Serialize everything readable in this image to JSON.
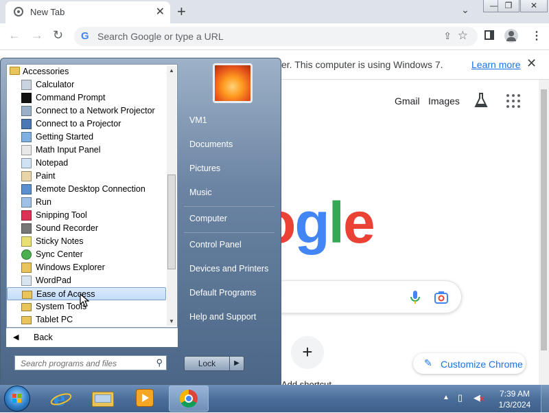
{
  "browser": {
    "tab_title": "New Tab",
    "tab_close": "✕",
    "new_tab": "+",
    "omnibox_placeholder": "Search Google or type a URL",
    "window_minimize": "—",
    "window_restore": "❐",
    "window_close": "✕"
  },
  "infobar": {
    "message": "er. This computer is using Windows 7.",
    "learn_more": "Learn more",
    "close": "✕"
  },
  "google": {
    "gmail": "Gmail",
    "images": "Images",
    "logo_text": "ogle",
    "add_shortcut_label": "Add shortcut",
    "customize_label": "Customize Chrome",
    "logo_colors": [
      "#4285f4",
      "#ea4335",
      "#fbbc05",
      "#4285f4",
      "#34a853",
      "#ea4335"
    ]
  },
  "start_menu": {
    "folder_title": "Accessories",
    "items": [
      {
        "label": "Calculator",
        "icon": "calculator-icon"
      },
      {
        "label": "Command Prompt",
        "icon": "command-prompt-icon"
      },
      {
        "label": "Connect to a Network Projector",
        "icon": "network-projector-icon"
      },
      {
        "label": "Connect to a Projector",
        "icon": "projector-icon"
      },
      {
        "label": "Getting Started",
        "icon": "getting-started-icon"
      },
      {
        "label": "Math Input Panel",
        "icon": "math-input-icon"
      },
      {
        "label": "Notepad",
        "icon": "notepad-icon"
      },
      {
        "label": "Paint",
        "icon": "paint-icon"
      },
      {
        "label": "Remote Desktop Connection",
        "icon": "remote-desktop-icon"
      },
      {
        "label": "Run",
        "icon": "run-icon"
      },
      {
        "label": "Snipping Tool",
        "icon": "snipping-tool-icon"
      },
      {
        "label": "Sound Recorder",
        "icon": "sound-recorder-icon"
      },
      {
        "label": "Sticky Notes",
        "icon": "sticky-notes-icon"
      },
      {
        "label": "Sync Center",
        "icon": "sync-center-icon"
      },
      {
        "label": "Windows Explorer",
        "icon": "windows-explorer-icon"
      },
      {
        "label": "WordPad",
        "icon": "wordpad-icon"
      },
      {
        "label": "Ease of Access",
        "icon": "folder-icon"
      },
      {
        "label": "System Tools",
        "icon": "folder-icon"
      },
      {
        "label": "Tablet PC",
        "icon": "folder-icon"
      }
    ],
    "selected_item": "Ease of Access",
    "back_label": "Back",
    "search_placeholder": "Search programs and files",
    "right_items": [
      "VM1",
      "Documents",
      "Pictures",
      "Music",
      "Computer",
      "Control Panel",
      "Devices and Printers",
      "Default Programs",
      "Help and Support"
    ],
    "lock_label": "Lock"
  },
  "taskbar": {
    "clock_time": "7:39 AM",
    "clock_date": "1/3/2024",
    "pinned": [
      "start-orb",
      "internet-explorer-icon",
      "windows-explorer-icon",
      "media-player-icon",
      "chrome-icon"
    ]
  }
}
